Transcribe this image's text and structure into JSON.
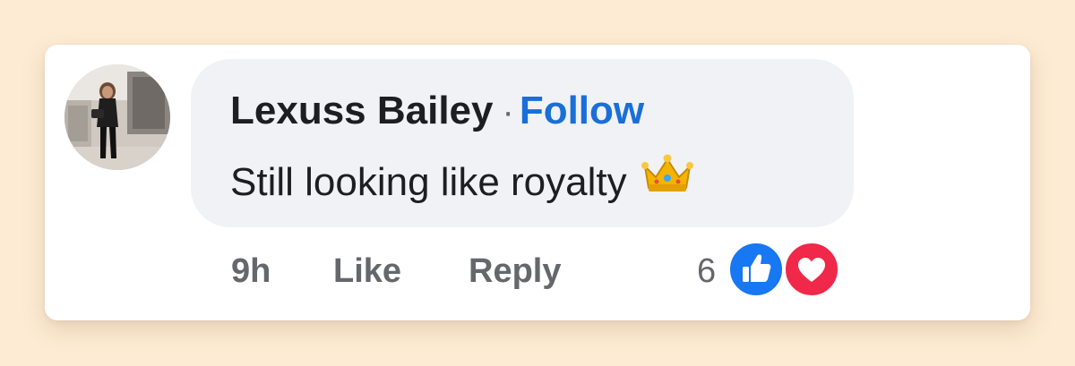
{
  "comment": {
    "author": "Lexuss Bailey",
    "separator": "·",
    "follow_label": "Follow",
    "text": "Still looking like royalty",
    "emoji_icon": "crown-emoji-icon",
    "time": "9h",
    "like_label": "Like",
    "reply_label": "Reply",
    "reaction_count": "6",
    "reactions": [
      "like-reaction-icon",
      "love-reaction-icon"
    ]
  },
  "colors": {
    "background": "#fdebd3",
    "card": "#ffffff",
    "bubble": "#f0f2f5",
    "follow": "#1a6ed8",
    "like_reaction": "#1877f2",
    "love_reaction": "#f02849",
    "muted_text": "#65676b"
  }
}
